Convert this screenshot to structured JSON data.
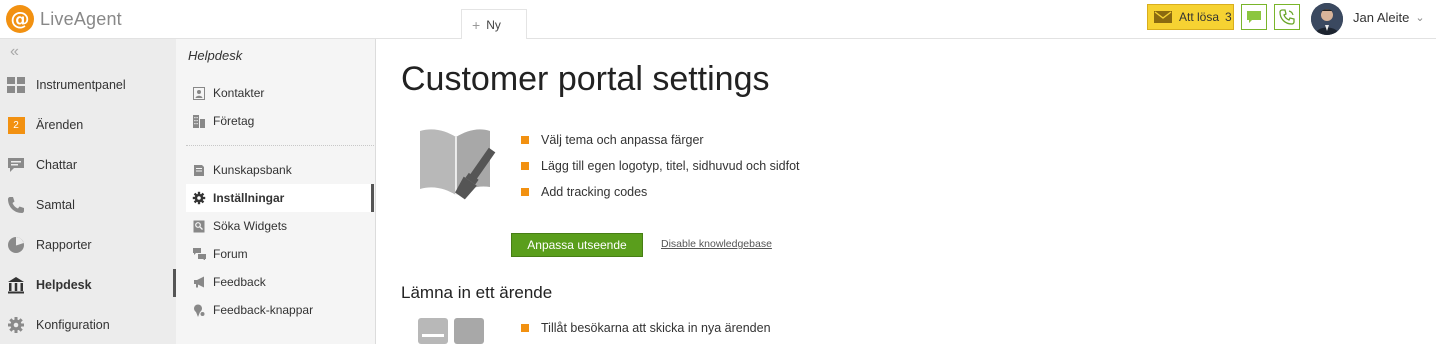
{
  "app": {
    "brand": "LiveAgent",
    "logo_glyph": "@",
    "accent": "#f29111"
  },
  "topbar": {
    "new_tab_label": "Ny",
    "att_losa_label": "Att lösa",
    "att_losa_count": "3",
    "user_name": "Jan Aleite"
  },
  "leftnav": {
    "collapse_glyph": "«",
    "items": [
      {
        "label": "Instrumentpanel",
        "icon": "dashboard-icon"
      },
      {
        "label": "Ärenden",
        "icon": "tickets-badge",
        "badge": "2"
      },
      {
        "label": "Chattar",
        "icon": "chat-icon"
      },
      {
        "label": "Samtal",
        "icon": "phone-icon"
      },
      {
        "label": "Rapporter",
        "icon": "reports-icon"
      },
      {
        "label": "Helpdesk",
        "icon": "helpdesk-icon",
        "active": true
      },
      {
        "label": "Konfiguration",
        "icon": "gear-icon"
      }
    ]
  },
  "subnav": {
    "title": "Helpdesk",
    "items": [
      {
        "label": "Kontakter",
        "icon": "contacts-icon"
      },
      {
        "label": "Företag",
        "icon": "company-icon"
      },
      {
        "label": "Kunskapsbank",
        "icon": "book-icon"
      },
      {
        "label": "Inställningar",
        "icon": "gear-icon",
        "active": true
      },
      {
        "label": "Söka Widgets",
        "icon": "widget-icon"
      },
      {
        "label": "Forum",
        "icon": "forum-icon"
      },
      {
        "label": "Feedback",
        "icon": "megaphone-icon"
      },
      {
        "label": "Feedback-knappar",
        "icon": "feedback-button-icon"
      }
    ]
  },
  "main": {
    "title": "Customer portal settings",
    "features": [
      "Välj tema och anpassa färger",
      "Lägg till egen logotyp, titel, sidhuvud och sidfot",
      "Add tracking codes"
    ],
    "primary_button": "Anpassa utseende",
    "secondary_link": "Disable knowledgebase",
    "section2_title": "Lämna in ett ärende",
    "section2_features": [
      "Tillåt besökarna att skicka in nya ärenden"
    ]
  }
}
